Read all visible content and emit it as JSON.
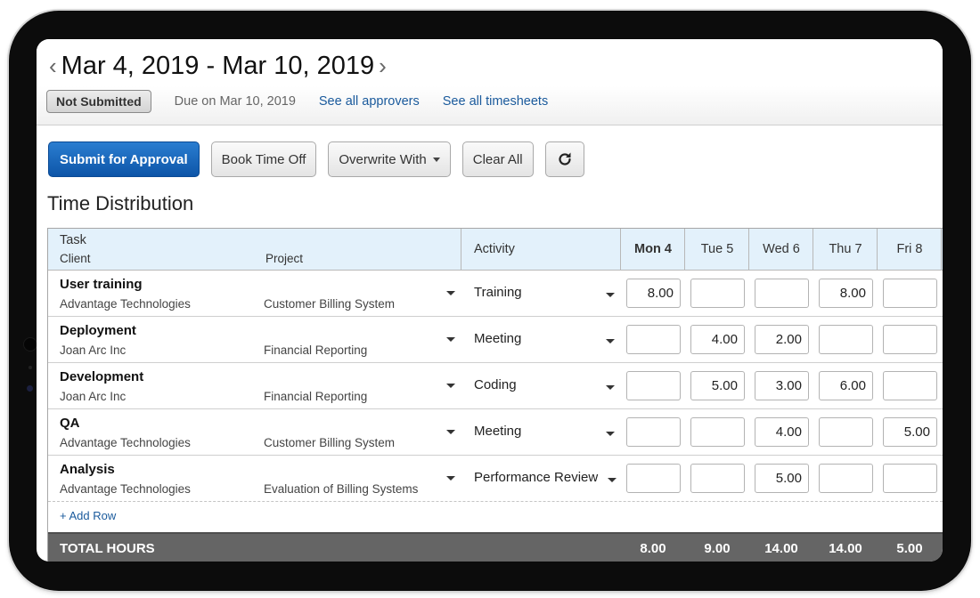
{
  "header": {
    "prev_label": "‹",
    "next_label": "›",
    "date_range": "Mar 4, 2019 - Mar 10, 2019",
    "status": "Not Submitted",
    "due": "Due on Mar 10, 2019",
    "approvers_link": "See all approvers",
    "timesheets_link": "See all timesheets"
  },
  "toolbar": {
    "submit_label": "Submit for Approval",
    "book_time_off_label": "Book Time Off",
    "overwrite_label": "Overwrite With",
    "clear_all_label": "Clear All",
    "refresh_icon": "refresh-icon"
  },
  "section_title": "Time Distribution",
  "table": {
    "headers": {
      "task": "Task",
      "client": "Client",
      "project": "Project",
      "activity": "Activity",
      "days": [
        "Mon 4",
        "Tue 5",
        "Wed 6",
        "Thu 7",
        "Fri 8"
      ]
    },
    "rows": [
      {
        "task": "User training",
        "client": "Advantage Technologies",
        "project": "Customer Billing System",
        "activity": "Training",
        "hours": [
          "8.00",
          "",
          "",
          "8.00",
          ""
        ]
      },
      {
        "task": "Deployment",
        "client": "Joan Arc Inc",
        "project": "Financial Reporting",
        "activity": "Meeting",
        "hours": [
          "",
          "4.00",
          "2.00",
          "",
          ""
        ]
      },
      {
        "task": "Development",
        "client": "Joan Arc Inc",
        "project": "Financial Reporting",
        "activity": "Coding",
        "hours": [
          "",
          "5.00",
          "3.00",
          "6.00",
          ""
        ]
      },
      {
        "task": "QA",
        "client": "Advantage Technologies",
        "project": "Customer Billing System",
        "activity": "Meeting",
        "hours": [
          "",
          "",
          "4.00",
          "",
          "5.00"
        ]
      },
      {
        "task": "Analysis",
        "client": "Advantage Technologies",
        "project": "Evaluation of Billing Systems",
        "activity": "Performance Review",
        "hours": [
          "",
          "",
          "5.00",
          "",
          ""
        ]
      }
    ],
    "add_row_label": "+ Add Row",
    "totals": {
      "label": "TOTAL HOURS",
      "values": [
        "8.00",
        "9.00",
        "14.00",
        "14.00",
        "5.00"
      ]
    }
  },
  "colors": {
    "primary_button": "#0d55a8",
    "link": "#1a5a9c",
    "header_bg": "#e3f1fb",
    "totals_bg": "#656565"
  }
}
